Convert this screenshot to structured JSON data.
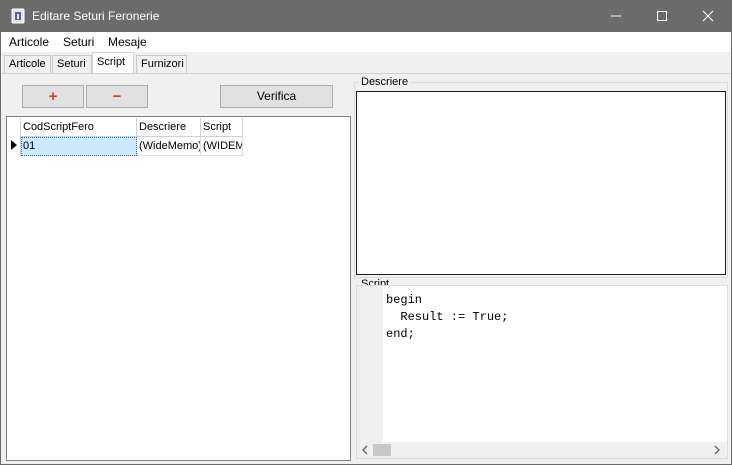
{
  "window": {
    "title": "Editare Seturi Feronerie"
  },
  "menu": {
    "items": [
      "Articole",
      "Seturi",
      "Mesaje"
    ]
  },
  "tabs": [
    "Articole",
    "Seturi",
    "Script",
    "Furnizori"
  ],
  "active_tab": "Script",
  "toolbar": {
    "add_label": "+",
    "remove_label": "−",
    "verify_label": "Verifica"
  },
  "grid": {
    "columns": [
      "CodScriptFero",
      "Descriere",
      "Script"
    ],
    "rows": [
      [
        "01",
        "(WideMemo)",
        "(WIDEM"
      ]
    ]
  },
  "descriere": {
    "label": "Descriere",
    "value": ""
  },
  "script": {
    "label": "Script",
    "lines": [
      "begin",
      "  Result := True;",
      "end;"
    ]
  },
  "colors": {
    "titlebar": "#6b6b6b",
    "add_icon": "#d8400c",
    "selection": "#cce8ff"
  },
  "icons": [
    "app-icon",
    "minimize-icon",
    "maximize-icon",
    "close-icon",
    "row-indicator-icon",
    "scroll-left-icon",
    "scroll-right-icon"
  ]
}
